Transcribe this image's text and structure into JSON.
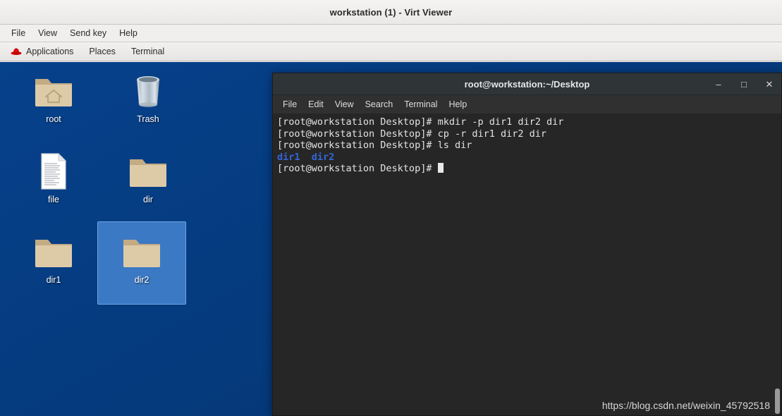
{
  "window": {
    "title": "workstation (1) - Virt Viewer",
    "menu": [
      {
        "label": "File",
        "name": "file"
      },
      {
        "label": "View",
        "name": "view"
      },
      {
        "label": "Send key",
        "name": "send-key"
      },
      {
        "label": "Help",
        "name": "help"
      }
    ]
  },
  "panel": {
    "logo_icon": "redhat-logo-icon",
    "items": [
      {
        "label": "Applications",
        "name": "applications"
      },
      {
        "label": "Places",
        "name": "places"
      },
      {
        "label": "Terminal",
        "name": "terminal"
      }
    ]
  },
  "desktop": {
    "background_color": "#053a7c",
    "selection_color": "#4888d4",
    "icons": [
      {
        "label": "root",
        "icon": "home-folder-icon",
        "selected": false
      },
      {
        "label": "Trash",
        "icon": "trash-can-icon",
        "selected": false
      },
      {
        "label": "file",
        "icon": "document-file-icon",
        "selected": false
      },
      {
        "label": "dir",
        "icon": "folder-icon",
        "selected": false
      },
      {
        "label": "dir1",
        "icon": "folder-icon",
        "selected": false
      },
      {
        "label": "dir2",
        "icon": "folder-icon",
        "selected": true
      }
    ]
  },
  "terminal": {
    "title": "root@workstation:~/Desktop",
    "controls": {
      "minimize": "–",
      "maximize": "□",
      "close": "✕"
    },
    "menu": [
      {
        "label": "File",
        "name": "file"
      },
      {
        "label": "Edit",
        "name": "edit"
      },
      {
        "label": "View",
        "name": "view"
      },
      {
        "label": "Search",
        "name": "search"
      },
      {
        "label": "Terminal",
        "name": "terminal"
      },
      {
        "label": "Help",
        "name": "help"
      }
    ],
    "prompt": "[root@workstation Desktop]# ",
    "lines": [
      {
        "text": "[root@workstation Desktop]# mkdir -p dir1 dir2 dir",
        "type": "command"
      },
      {
        "text": "[root@workstation Desktop]# cp -r dir1 dir2 dir",
        "type": "command"
      },
      {
        "text": "[root@workstation Desktop]# ls dir",
        "type": "command"
      },
      {
        "text": "dir1  dir2",
        "type": "output-dir"
      },
      {
        "text": "[root@workstation Desktop]# ",
        "type": "prompt-cursor"
      }
    ],
    "dir_color": "#3465d8",
    "background_color": "#262626",
    "watermark": "https://blog.csdn.net/weixin_45792518"
  }
}
